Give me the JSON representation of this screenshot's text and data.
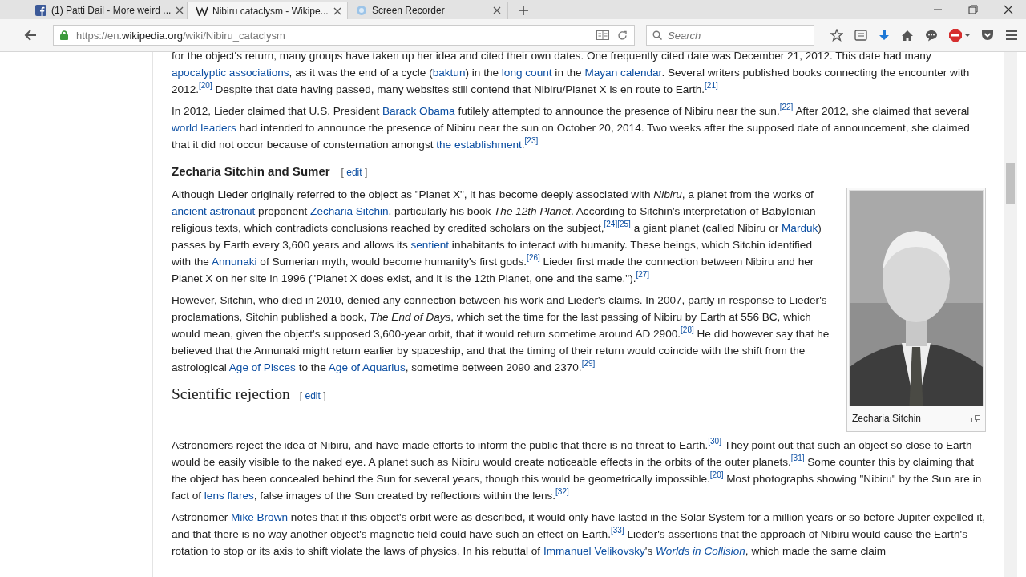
{
  "browser": {
    "tabs": [
      {
        "kind": "social",
        "title": "(1) Patti Dail - More weird ...",
        "selected": false
      },
      {
        "kind": "wiki",
        "title": "Nibiru cataclysm - Wikipe...",
        "selected": true
      },
      {
        "kind": "recorder",
        "title": "Screen Recorder",
        "selected": false
      }
    ],
    "url_prefix": "https://en.",
    "url_domain": "wikipedia.org",
    "url_path": "/wiki/Nibiru_cataclysm",
    "search": {
      "placeholder": "Search"
    }
  },
  "article": {
    "blocks": [
      {
        "kind": "paragraph",
        "parts": [
          {
            "kind": "text",
            "text": "for the object's return, many groups have taken up her idea and cited their own dates. One frequently cited date was December 21, 2012. This date had many "
          },
          {
            "kind": "link",
            "text": "apocalyptic associations"
          },
          {
            "kind": "text",
            "text": ", as it was the end of a cycle ("
          },
          {
            "kind": "link",
            "text": "baktun"
          },
          {
            "kind": "text",
            "text": ") in the "
          },
          {
            "kind": "link",
            "text": "long count"
          },
          {
            "kind": "text",
            "text": " in the "
          },
          {
            "kind": "link",
            "text": "Mayan calendar"
          },
          {
            "kind": "text",
            "text": ". Several writers published books connecting the encounter with 2012."
          },
          {
            "kind": "ref",
            "text": "[20]"
          },
          {
            "kind": "text",
            "text": " Despite that date having passed, many websites still contend that Nibiru/Planet X is en route to Earth."
          },
          {
            "kind": "ref",
            "text": "[21]"
          }
        ]
      },
      {
        "kind": "paragraph",
        "parts": [
          {
            "kind": "text",
            "text": "In 2012, Lieder claimed that U.S. President "
          },
          {
            "kind": "link",
            "text": "Barack Obama"
          },
          {
            "kind": "text",
            "text": " futilely attempted to announce the presence of Nibiru near the sun."
          },
          {
            "kind": "ref",
            "text": "[22]"
          },
          {
            "kind": "text",
            "text": " After 2012, she claimed that several "
          },
          {
            "kind": "link",
            "text": "world leaders"
          },
          {
            "kind": "text",
            "text": " had intended to announce the presence of Nibiru near the sun on October 20, 2014. Two weeks after the supposed date of announcement, she claimed that it did not occur because of consternation amongst "
          },
          {
            "kind": "link",
            "text": "the establishment"
          },
          {
            "kind": "text",
            "text": "."
          },
          {
            "kind": "ref",
            "text": "[23]"
          }
        ]
      },
      {
        "kind": "h3",
        "title": "Zecharia Sitchin and Sumer",
        "bracket_open": "[",
        "edit": "edit",
        "bracket_close": "]"
      },
      {
        "kind": "with_figure",
        "figure": {
          "caption": "Zecharia Sitchin"
        },
        "blocks": [
          {
            "kind": "paragraph",
            "parts": [
              {
                "kind": "text",
                "text": "Although Lieder originally referred to the object as \"Planet X\", it has become deeply associated with *Nibiru*, a planet from the works of "
              },
              {
                "kind": "link",
                "text": "ancient astronaut"
              },
              {
                "kind": "text",
                "text": " proponent "
              },
              {
                "kind": "link",
                "text": "Zecharia Sitchin"
              },
              {
                "kind": "text",
                "text": ", particularly his book *The 12th Planet*. According to Sitchin's interpretation of Babylonian religious texts, which contradicts conclusions reached by credited scholars on the subject,"
              },
              {
                "kind": "ref",
                "text": "[24]"
              },
              {
                "kind": "ref",
                "text": "[25]"
              },
              {
                "kind": "text",
                "text": " a giant planet (called Nibiru or "
              },
              {
                "kind": "link",
                "text": "Marduk"
              },
              {
                "kind": "text",
                "text": ") passes by Earth every 3,600 years and allows its "
              },
              {
                "kind": "link",
                "text": "sentient"
              },
              {
                "kind": "text",
                "text": " inhabitants to interact with humanity. These beings, which Sitchin identified with the "
              },
              {
                "kind": "link",
                "text": "Annunaki"
              },
              {
                "kind": "text",
                "text": " of Sumerian myth, would become humanity's first gods."
              },
              {
                "kind": "ref",
                "text": "[26]"
              },
              {
                "kind": "text",
                "text": " Lieder first made the connection between Nibiru and her Planet X on her site in 1996 (\"Planet X does exist, and it is the 12th Planet, one and the same.\")."
              },
              {
                "kind": "ref",
                "text": "[27]"
              }
            ]
          },
          {
            "kind": "paragraph",
            "parts": [
              {
                "kind": "text",
                "text": "However, Sitchin, who died in 2010, denied any connection between his work and Lieder's claims. In 2007, partly in response to Lieder's proclamations, Sitchin published a book, *The End of Days*, which set the time for the last passing of Nibiru by Earth at 556 BC, which would mean, given the object's supposed 3,600-year orbit, that it would return sometime around AD 2900."
              },
              {
                "kind": "ref",
                "text": "[28]"
              },
              {
                "kind": "text",
                "text": " He did however say that he believed that the Annunaki might return earlier by spaceship, and that the timing of their return would coincide with the shift from the astrological "
              },
              {
                "kind": "link",
                "text": "Age of Pisces"
              },
              {
                "kind": "text",
                "text": " to the "
              },
              {
                "kind": "link",
                "text": "Age of Aquarius"
              },
              {
                "kind": "text",
                "text": ", sometime between 2090 and 2370."
              },
              {
                "kind": "ref",
                "text": "[29]"
              }
            ]
          },
          {
            "kind": "h2",
            "title": "Scientific rejection",
            "bracket_open": "[",
            "edit": "edit",
            "bracket_close": "]"
          }
        ]
      },
      {
        "kind": "paragraph",
        "parts": [
          {
            "kind": "text",
            "text": "Astronomers reject the idea of Nibiru, and have made efforts to inform the public that there is no threat to Earth."
          },
          {
            "kind": "ref",
            "text": "[30]"
          },
          {
            "kind": "text",
            "text": " They point out that such an object so close to Earth would be easily visible to the naked eye. A planet such as Nibiru would create noticeable effects in the orbits of the outer planets."
          },
          {
            "kind": "ref",
            "text": "[31]"
          },
          {
            "kind": "text",
            "text": " Some counter this by claiming that the object has been concealed behind the Sun for several years, though this would be geometrically impossible."
          },
          {
            "kind": "ref",
            "text": "[20]"
          },
          {
            "kind": "text",
            "text": " Most photographs showing \"Nibiru\" by the Sun are in fact of "
          },
          {
            "kind": "link",
            "text": "lens flares"
          },
          {
            "kind": "text",
            "text": ", false images of the Sun created by reflections within the lens."
          },
          {
            "kind": "ref",
            "text": "[32]"
          }
        ]
      },
      {
        "kind": "paragraph",
        "parts": [
          {
            "kind": "text",
            "text": "Astronomer "
          },
          {
            "kind": "link",
            "text": "Mike Brown"
          },
          {
            "kind": "text",
            "text": " notes that if this object's orbit were as described, it would only have lasted in the Solar System for a million years or so before Jupiter expelled it, and that there is no way another object's magnetic field could have such an effect on Earth."
          },
          {
            "kind": "ref",
            "text": "[33]"
          },
          {
            "kind": "text",
            "text": " Lieder's assertions that the approach of Nibiru would cause the Earth's rotation to stop or its axis to shift violate the laws of physics. In his rebuttal of "
          },
          {
            "kind": "link",
            "text": "Immanuel Velikovsky"
          },
          {
            "kind": "text",
            "text": "'s "
          },
          {
            "kind": "link",
            "text": "*Worlds in Collision*"
          },
          {
            "kind": "text",
            "text": ", which made the same claim"
          }
        ]
      }
    ]
  }
}
